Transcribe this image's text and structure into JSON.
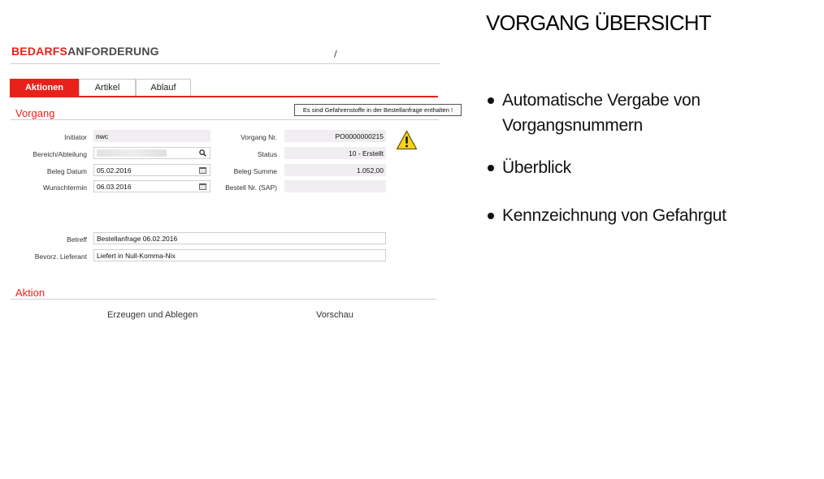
{
  "slide": {
    "title": "VORGANG ÜBERSICHT",
    "bullets": [
      "Automatische Vergabe von Vorgangsnummern",
      "Überblick",
      "Kennzeichnung von Gefahrgut"
    ]
  },
  "app": {
    "title_accent": "BEDARFS",
    "title_rest": "ANFORDERUNG",
    "title_separator": "/",
    "tabs": [
      {
        "label": "Aktionen",
        "active": true
      },
      {
        "label": "Artikel",
        "active": false
      },
      {
        "label": "Ablauf",
        "active": false
      }
    ],
    "warning_message": "Es sind Gefahrenstoffe in der Bestellanfrage enthalten !",
    "sections": {
      "vorgang": "Vorgang",
      "aktion": "Aktion"
    },
    "fields": {
      "initiator": {
        "label": "Initiator",
        "value": "nwc"
      },
      "bereich": {
        "label": "Bereich/Abteilung",
        "value": ""
      },
      "beleg_datum": {
        "label": "Beleg Datum",
        "value": "05.02.2016"
      },
      "wunschtermin": {
        "label": "Wunschtermin",
        "value": "06.03.2016"
      },
      "vorgang_nr": {
        "label": "Vorgang Nr.",
        "value": "PO0000000215"
      },
      "status": {
        "label": "Status",
        "value": "10 - Erstellt"
      },
      "beleg_summe": {
        "label": "Beleg Summe",
        "value": "1.052,00"
      },
      "bestell_nr": {
        "label": "Bestell Nr. (SAP)",
        "value": ""
      },
      "betreff": {
        "label": "Betreff",
        "value": "Bestellanfrage 06.02.2016"
      },
      "lieferant": {
        "label": "Bevorz. Lieferant",
        "value": "Liefert in Null-Komma-Nix"
      }
    },
    "actions": {
      "create": "Erzeugen und Ablegen",
      "preview": "Vorschau"
    }
  },
  "colors": {
    "accent": "#e8221b",
    "readonly_bg": "#f1eef1",
    "warning_yellow": "#f7d31b"
  }
}
